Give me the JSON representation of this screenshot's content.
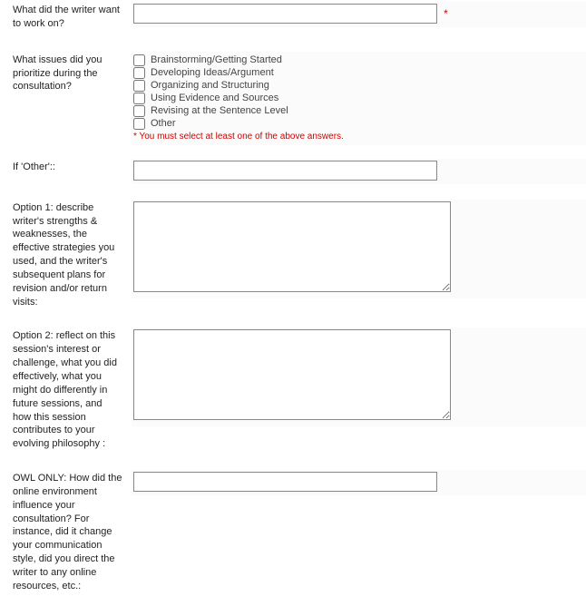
{
  "fields": {
    "q1": {
      "label": "What did the writer want to work on?",
      "required_marker": "*"
    },
    "q2": {
      "label": "What issues did you prioritize during the consultation?",
      "options": [
        "Brainstorming/Getting Started",
        "Developing Ideas/Argument",
        "Organizing and Structuring",
        "Using Evidence and Sources",
        "Revising at the Sentence Level",
        "Other"
      ],
      "validation": "* You must select at least one of the above answers."
    },
    "q3": {
      "label": "If 'Other'::"
    },
    "q4": {
      "label": "Option 1: describe writer's strengths & weaknesses, the effective strategies you used, and the writer's subsequent plans for revision and/or return visits:"
    },
    "q5": {
      "label": "Option 2: reflect on this session's interest or challenge, what you did effectively, what you might do differently in future sessions, and how this session contributes to your evolving philosophy :"
    },
    "q6": {
      "label": "OWL ONLY: How did the online environment influence your consultation? For instance, did it change your communication style, did you direct the writer to any online resources, etc.:"
    }
  }
}
